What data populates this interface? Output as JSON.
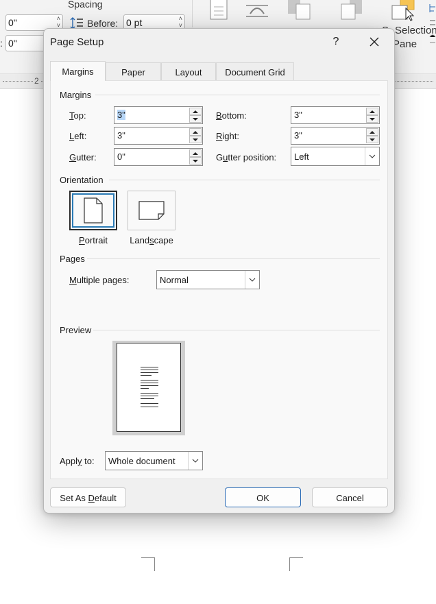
{
  "background": {
    "ribbon": {
      "spacing_label": "Spacing",
      "indent_left_value": "0\"",
      "indent_right_value": "0\"",
      "before_label": "Before:",
      "before_value": "0 pt",
      "selection_pane_label_line1": "Selection",
      "selection_pane_label_line2": "Pane",
      "selection_pane_prefix": "S"
    },
    "ruler": {
      "number": "2"
    }
  },
  "dialog": {
    "title": "Page Setup",
    "help_label": "?",
    "tabs": [
      {
        "label": "Margins"
      },
      {
        "label": "Paper"
      },
      {
        "label": "Layout"
      },
      {
        "label": "Document Grid"
      }
    ],
    "active_tab": "Margins",
    "margins": {
      "section_label": "Margins",
      "top": {
        "label_key": "T",
        "label_rest": "op:",
        "value": "3\""
      },
      "left": {
        "label_key": "L",
        "label_rest": "eft:",
        "value": "3\""
      },
      "gutter": {
        "label_key": "G",
        "label_rest": "utter:",
        "value": "0\""
      },
      "bottom": {
        "label_key": "B",
        "label_rest": "ottom:",
        "value": "3\""
      },
      "right": {
        "label_key": "R",
        "label_rest": "ight:",
        "value": "3\""
      },
      "gutter_position": {
        "label_pre": "G",
        "label_key": "u",
        "label_rest": "tter position:",
        "value": "Left"
      }
    },
    "orientation": {
      "section_label": "Orientation",
      "portrait": {
        "label_key": "P",
        "label_rest": "ortrait"
      },
      "landscape": {
        "label_pre": "Land",
        "label_key": "s",
        "label_rest": "cape"
      },
      "selected": "Portrait"
    },
    "pages": {
      "section_label": "Pages",
      "multiple_pages": {
        "label_key": "M",
        "label_rest": "ultiple pages:",
        "value": "Normal"
      }
    },
    "preview": {
      "section_label": "Preview",
      "apply_to": {
        "label_pre": "Appl",
        "label_key": "y",
        "label_rest": " to:",
        "value": "Whole document"
      }
    },
    "buttons": {
      "set_default": {
        "label_pre": "Set As ",
        "label_key": "D",
        "label_rest": "efault"
      },
      "ok": "OK",
      "cancel": "Cancel"
    },
    "colors": {
      "accent": "#2a7ab5",
      "selection_highlight": "#b7d6f7"
    }
  }
}
